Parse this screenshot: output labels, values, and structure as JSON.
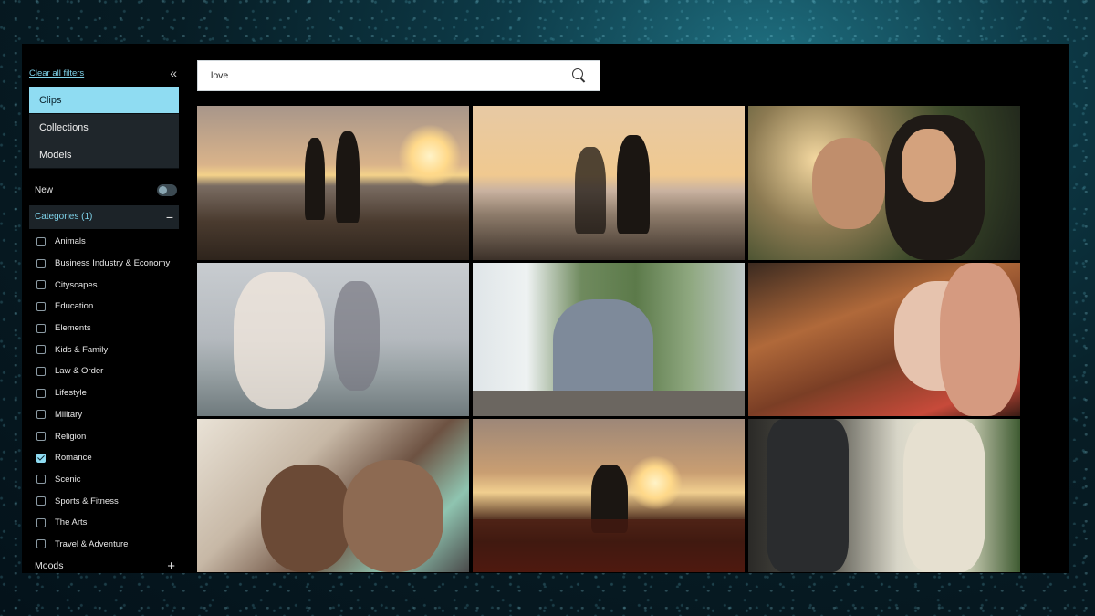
{
  "sidebar": {
    "clear_filters": "Clear all filters",
    "collapse_icon": "double-chevron-left-icon",
    "tabs": [
      {
        "label": "Clips",
        "active": true
      },
      {
        "label": "Collections",
        "active": false
      },
      {
        "label": "Models",
        "active": false
      }
    ],
    "new_label": "New",
    "new_toggle_on": false,
    "categories_header": "Categories (1)",
    "categories": [
      {
        "label": "Animals",
        "checked": false
      },
      {
        "label": "Business Industry & Economy",
        "checked": false
      },
      {
        "label": "Cityscapes",
        "checked": false
      },
      {
        "label": "Education",
        "checked": false
      },
      {
        "label": "Elements",
        "checked": false
      },
      {
        "label": "Kids & Family",
        "checked": false
      },
      {
        "label": "Law & Order",
        "checked": false
      },
      {
        "label": "Lifestyle",
        "checked": false
      },
      {
        "label": "Military",
        "checked": false
      },
      {
        "label": "Religion",
        "checked": false
      },
      {
        "label": "Romance",
        "checked": true
      },
      {
        "label": "Scenic",
        "checked": false
      },
      {
        "label": "Sports & Fitness",
        "checked": false
      },
      {
        "label": "The Arts",
        "checked": false
      },
      {
        "label": "Travel & Adventure",
        "checked": false
      }
    ],
    "moods_label": "Moods"
  },
  "search": {
    "value": "love",
    "icon": "search-icon"
  },
  "colors": {
    "accent": "#8fdcf2",
    "link": "#7fd3ea",
    "panel": "#000000"
  }
}
